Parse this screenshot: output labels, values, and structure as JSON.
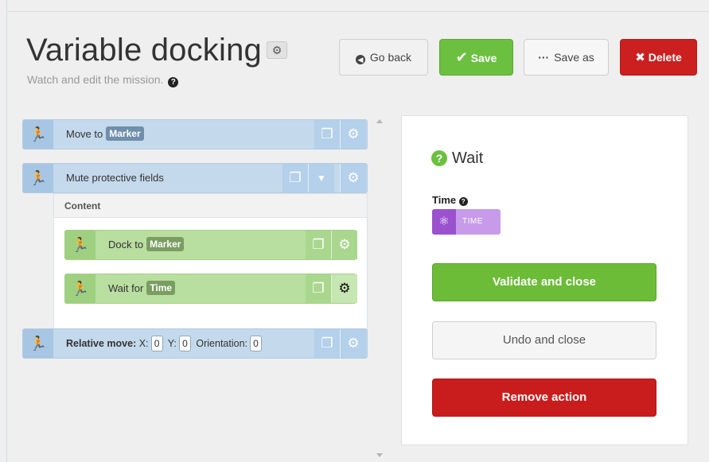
{
  "header": {
    "title": "Variable docking",
    "subtitle": "Watch and edit the mission."
  },
  "toolbar": {
    "go_back_label": "Go back",
    "save_label": "Save",
    "save_as_label": "Save as",
    "delete_label": "Delete"
  },
  "mission": {
    "move_to": {
      "label": "Move to",
      "tag": "Marker"
    },
    "mute": {
      "label": "Mute protective fields",
      "content_label": "Content"
    },
    "dock_to": {
      "label": "Dock to",
      "tag": "Marker"
    },
    "wait_for": {
      "label": "Wait for",
      "tag": "Time"
    },
    "relative_move": {
      "label": "Relative move:",
      "x_label": "X:",
      "x_value": "0",
      "y_label": "Y:",
      "y_value": "0",
      "orientation_label": "Orientation:",
      "orientation_value": "0"
    }
  },
  "editor": {
    "action_title": "Wait",
    "param_label": "Time",
    "param_value": "TIME",
    "validate_label": "Validate and close",
    "undo_label": "Undo and close",
    "remove_label": "Remove action"
  },
  "colors": {
    "action_blue": "#c4d9ec",
    "action_green": "#b8dea0",
    "save_green": "#6cc040",
    "delete_red": "#cc1f1f",
    "variable_purple": "#9a52cf"
  },
  "icons": [
    "gear-icon",
    "question-icon",
    "arrow-left-icon",
    "checkmark-icon",
    "ellipsis-icon",
    "x-icon",
    "running-man-icon",
    "copy-icon",
    "caret-down-icon",
    "variable-icon"
  ]
}
